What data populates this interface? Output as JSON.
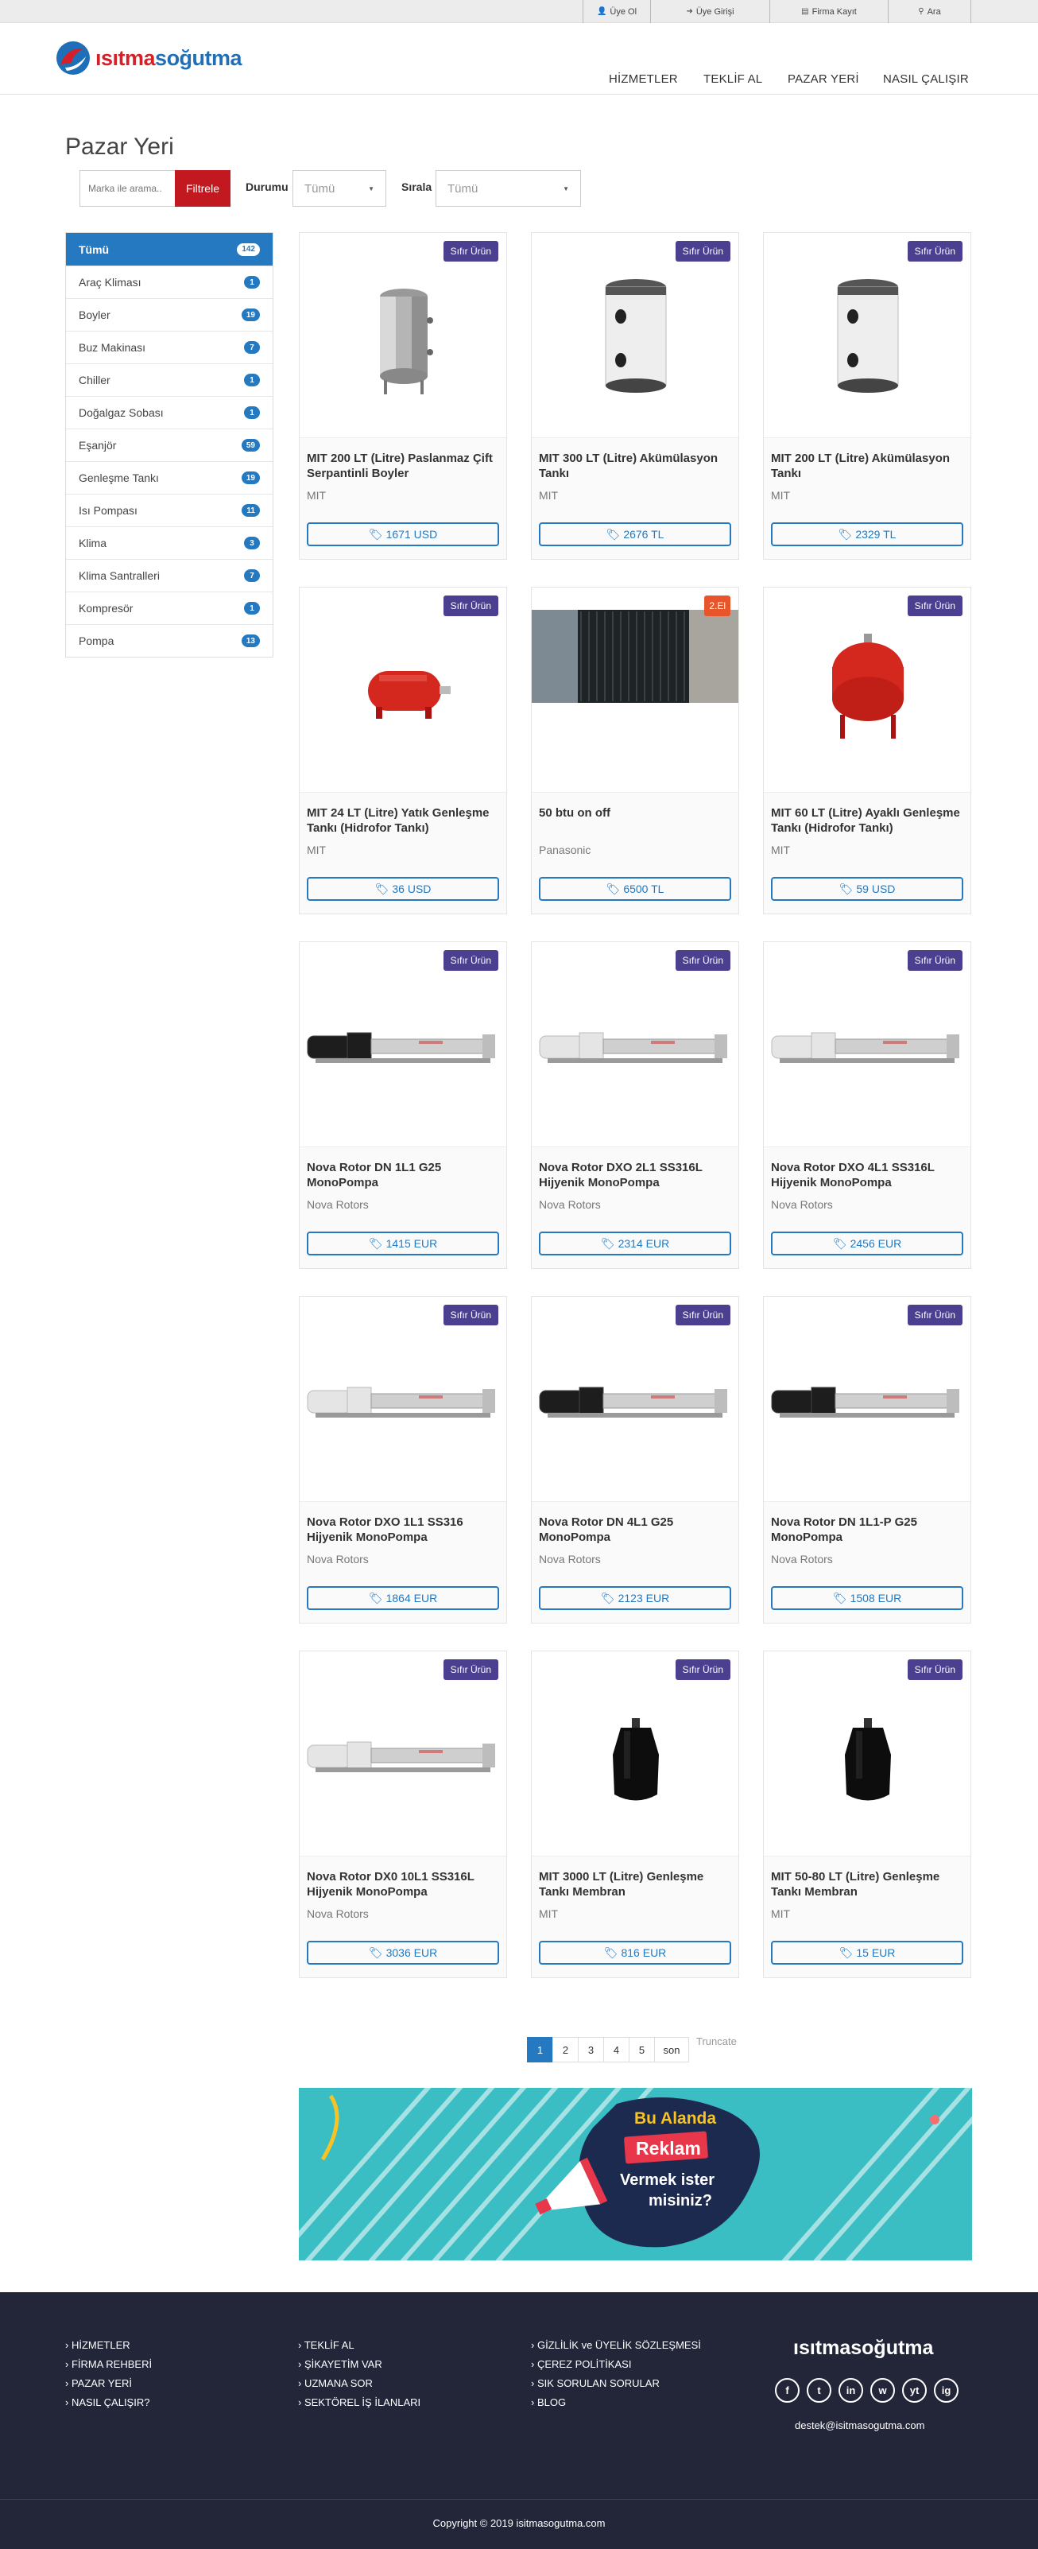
{
  "topbar": {
    "register": "Üye Ol",
    "login": "Üye Girişi",
    "firm_register": "Firma Kayıt",
    "search": "Ara"
  },
  "brand": {
    "part1": "ısıtma",
    "part2": "soğutma",
    "footer": "ısıtmasoğutma"
  },
  "nav": {
    "items": [
      "HİZMETLER",
      "TEKLİF AL",
      "PAZAR YERİ",
      "NASIL ÇALIŞIR"
    ]
  },
  "page": {
    "title": "Pazar Yeri"
  },
  "filter": {
    "placeholder": "Marka ile arama..",
    "button": "Filtrele",
    "status_label": "Durumu",
    "status_value": "Tümü",
    "sort_label": "Sırala",
    "sort_value": "Tümü"
  },
  "categories": [
    {
      "label": "Tümü",
      "count": "142"
    },
    {
      "label": "Araç Kliması",
      "count": "1"
    },
    {
      "label": "Boyler",
      "count": "19"
    },
    {
      "label": "Buz Makinası",
      "count": "7"
    },
    {
      "label": "Chiller",
      "count": "1"
    },
    {
      "label": "Doğalgaz Sobası",
      "count": "1"
    },
    {
      "label": "Eşanjör",
      "count": "59"
    },
    {
      "label": "Genleşme Tankı",
      "count": "19"
    },
    {
      "label": "Isı Pompası",
      "count": "11"
    },
    {
      "label": "Klima",
      "count": "3"
    },
    {
      "label": "Klima Santralleri",
      "count": "7"
    },
    {
      "label": "Kompresör",
      "count": "1"
    },
    {
      "label": "Pompa",
      "count": "13"
    }
  ],
  "products": [
    {
      "title": "MIT 200 LT (Litre) Paslanmaz Çift Serpantinli Boyler",
      "brand": "MIT",
      "price": "1671 USD",
      "badge": "Sıfır Ürün",
      "img": "steel-boiler"
    },
    {
      "title": "MIT 300 LT (Litre) Akümülasyon Tankı",
      "brand": "MIT",
      "price": "2676 TL",
      "badge": "Sıfır Ürün",
      "img": "white-tank"
    },
    {
      "title": "MIT 200 LT (Litre) Akümülasyon Tankı",
      "brand": "MIT",
      "price": "2329 TL",
      "badge": "Sıfır Ürün",
      "img": "white-tank"
    },
    {
      "title": "MIT 24 LT (Litre) Yatık Genleşme Tankı (Hidrofor Tankı)",
      "brand": "MIT",
      "price": "36 USD",
      "badge": "Sıfır Ürün",
      "img": "red-horizontal-tank"
    },
    {
      "title": "50 btu on off",
      "brand": "Panasonic",
      "price": "6500 TL",
      "badge": "2.El",
      "img": "photo"
    },
    {
      "title": "MIT 60 LT (Litre) Ayaklı Genleşme Tankı (Hidrofor Tankı)",
      "brand": "MIT",
      "price": "59 USD",
      "badge": "Sıfır Ürün",
      "img": "red-vertical-tank"
    },
    {
      "title": "Nova Rotor DN 1L1 G25 MonoPompa",
      "brand": "Nova Rotors",
      "price": "1415 EUR",
      "badge": "Sıfır Ürün",
      "img": "pump-dark"
    },
    {
      "title": "Nova Rotor DXO 2L1 SS316L Hijyenik MonoPompa",
      "brand": "Nova Rotors",
      "price": "2314 EUR",
      "badge": "Sıfır Ürün",
      "img": "pump-light"
    },
    {
      "title": "Nova Rotor DXO 4L1 SS316L Hijyenik MonoPompa",
      "brand": "Nova Rotors",
      "price": "2456 EUR",
      "badge": "Sıfır Ürün",
      "img": "pump-light"
    },
    {
      "title": "Nova Rotor DXO 1L1 SS316 Hijyenik MonoPompa",
      "brand": "Nova Rotors",
      "price": "1864 EUR",
      "badge": "Sıfır Ürün",
      "img": "pump-light"
    },
    {
      "title": "Nova Rotor DN 4L1 G25 MonoPompa",
      "brand": "Nova Rotors",
      "price": "2123 EUR",
      "badge": "Sıfır Ürün",
      "img": "pump-dark"
    },
    {
      "title": "Nova Rotor DN 1L1-P G25 MonoPompa",
      "brand": "Nova Rotors",
      "price": "1508 EUR",
      "badge": "Sıfır Ürün",
      "img": "pump-dark"
    },
    {
      "title": "Nova Rotor DX0 10L1 SS316L Hijyenik MonoPompa",
      "brand": "Nova Rotors",
      "price": "3036 EUR",
      "badge": "Sıfır Ürün",
      "img": "pump-light"
    },
    {
      "title": "MIT 3000 LT (Litre) Genleşme Tankı Membran",
      "brand": "MIT",
      "price": "816 EUR",
      "badge": "Sıfır Ürün",
      "img": "black-membrane"
    },
    {
      "title": "MIT 50-80 LT (Litre) Genleşme Tankı Membran",
      "brand": "MIT",
      "price": "15 EUR",
      "badge": "Sıfır Ürün",
      "img": "black-membrane"
    }
  ],
  "pagination": {
    "pages": [
      "1",
      "2",
      "3",
      "4",
      "5"
    ],
    "last": "son",
    "note": "Truncate"
  },
  "ad": {
    "line1": "Bu Alanda",
    "line2": "Reklam",
    "line3": "Vermek ister",
    "line4": "misiniz?"
  },
  "footer": {
    "col1": [
      "HİZMETLER",
      "FİRMA REHBERİ",
      "PAZAR YERİ",
      "NASIL ÇALIŞIR?"
    ],
    "col2": [
      "TEKLİF AL",
      "ŞİKAYETİM VAR",
      "UZMANA SOR",
      "SEKTÖREL İŞ İLANLARI"
    ],
    "col3": [
      "GİZLİLİK ve ÜYELİK SÖZLEŞMESİ",
      "ÇEREZ POLİTİKASI",
      "SIK SORULAN SORULAR",
      "BLOG"
    ],
    "email": "destek@isitmasogutma.com",
    "copyright": "Copyright © 2019 isitmasogutma.com",
    "social": [
      "f",
      "t",
      "in",
      "w",
      "yt",
      "ig"
    ]
  }
}
